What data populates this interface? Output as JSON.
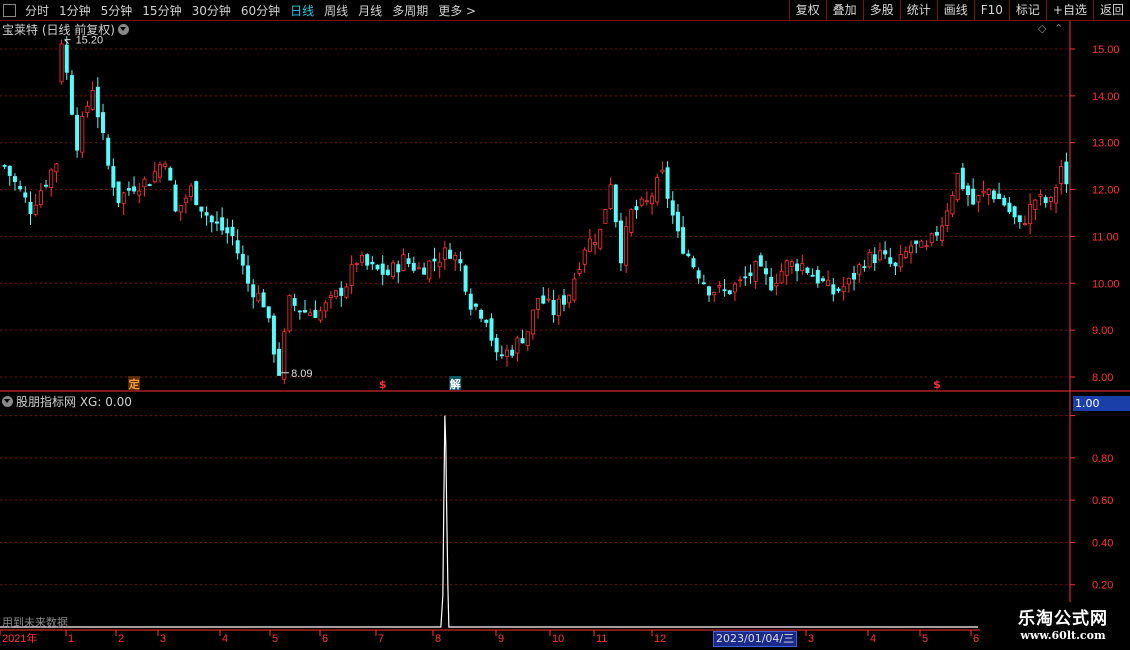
{
  "toolbar": {
    "periods": [
      "分时",
      "1分钟",
      "5分钟",
      "15分钟",
      "30分钟",
      "60分钟",
      "日线",
      "周线",
      "月线",
      "多周期",
      "更多 >"
    ],
    "active_period": "日线",
    "tools": [
      "复权",
      "叠加",
      "多股",
      "统计",
      "画线",
      "F10",
      "标记",
      "+自选",
      "返回"
    ]
  },
  "main_panel": {
    "title": "宝莱特 (日线 前复权)",
    "high_label": "15.20",
    "low_label": "8.09",
    "price_axis": [
      "15.00",
      "14.00",
      "13.00",
      "12.00",
      "11.00",
      "10.00",
      "9.00",
      "8.00"
    ],
    "markers": [
      {
        "text": "定",
        "color": "#ffa040",
        "bg": "#5a2a00",
        "index": 25
      },
      {
        "text": "$",
        "color": "#ff3030",
        "bg": "#000000",
        "index": 73
      },
      {
        "text": "解",
        "color": "#ffffff",
        "bg": "#0a5a6a",
        "index": 87
      },
      {
        "text": "$",
        "color": "#ff3030",
        "bg": "#000000",
        "index": 180
      }
    ]
  },
  "indicator_panel": {
    "title": "股朋指标网 XG: 0.00",
    "value_label": "1.00",
    "axis": [
      "1.00",
      "0.80",
      "0.60",
      "0.40",
      "0.20"
    ],
    "note": "用到未来数据"
  },
  "date_axis": {
    "labels": [
      "2021年",
      "1",
      "2",
      "3",
      "4",
      "5",
      "6",
      "7",
      "8",
      "9",
      "10",
      "11",
      "12",
      "3",
      "4",
      "5",
      "6"
    ],
    "cursor_date": "2023/01/04/三"
  },
  "watermark": {
    "line1": "乐淘公式网",
    "line2": "www.60lt.com"
  },
  "colors": {
    "up": "#ff3232",
    "down": "#54fcfc",
    "axis": "#ff3232",
    "grid": "#7a1010",
    "accent": "#2ec7e6"
  },
  "chart_data": {
    "type": "candlestick",
    "title": "宝莱特 (日线 前复权)",
    "xlabel": "",
    "ylabel": "",
    "ylim": [
      7.8,
      15.6
    ],
    "x_ticks": [
      "2021年",
      "1",
      "2",
      "3",
      "4",
      "5",
      "6",
      "7",
      "8",
      "9",
      "10",
      "11",
      "12",
      "3",
      "4",
      "5",
      "6"
    ],
    "y_ticks": [
      8,
      9,
      10,
      11,
      12,
      13,
      14,
      15
    ],
    "grid": true,
    "annotations": [
      {
        "text": "15.20",
        "value": 15.2
      },
      {
        "text": "8.09",
        "value": 8.09
      }
    ],
    "close_path": [
      [
        0,
        12.5
      ],
      [
        5,
        11.6
      ],
      [
        8,
        12.2
      ],
      [
        10,
        12.6
      ],
      [
        11,
        15.2
      ],
      [
        14,
        13.0
      ],
      [
        17,
        14.2
      ],
      [
        20,
        12.5
      ],
      [
        22,
        11.8
      ],
      [
        25,
        12.1
      ],
      [
        28,
        12.2
      ],
      [
        31,
        12.7
      ],
      [
        33,
        11.5
      ],
      [
        36,
        12.0
      ],
      [
        40,
        11.3
      ],
      [
        44,
        11.0
      ],
      [
        47,
        10.0
      ],
      [
        50,
        9.6
      ],
      [
        53,
        8.1
      ],
      [
        55,
        9.6
      ],
      [
        58,
        9.4
      ],
      [
        61,
        9.4
      ],
      [
        63,
        9.6
      ],
      [
        66,
        10.0
      ],
      [
        68,
        10.5
      ],
      [
        71,
        10.3
      ],
      [
        74,
        10.2
      ],
      [
        77,
        10.5
      ],
      [
        80,
        10.3
      ],
      [
        83,
        10.5
      ],
      [
        86,
        10.7
      ],
      [
        88,
        10.4
      ],
      [
        90,
        9.6
      ],
      [
        93,
        9.3
      ],
      [
        95,
        8.4
      ],
      [
        98,
        8.6
      ],
      [
        101,
        9.0
      ],
      [
        103,
        9.7
      ],
      [
        106,
        9.4
      ],
      [
        109,
        9.8
      ],
      [
        112,
        10.8
      ],
      [
        115,
        11.1
      ],
      [
        117,
        12.2
      ],
      [
        119,
        10.6
      ],
      [
        121,
        11.5
      ],
      [
        124,
        11.7
      ],
      [
        127,
        12.3
      ],
      [
        130,
        11.0
      ],
      [
        133,
        10.4
      ],
      [
        136,
        9.9
      ],
      [
        139,
        9.8
      ],
      [
        142,
        10.0
      ],
      [
        145,
        10.3
      ],
      [
        148,
        10.0
      ],
      [
        151,
        10.4
      ],
      [
        154,
        10.4
      ],
      [
        157,
        10.1
      ],
      [
        160,
        9.8
      ],
      [
        163,
        10.0
      ],
      [
        166,
        10.5
      ],
      [
        169,
        10.6
      ],
      [
        172,
        10.3
      ],
      [
        175,
        10.8
      ],
      [
        178,
        10.7
      ],
      [
        181,
        11.3
      ],
      [
        184,
        12.3
      ],
      [
        187,
        11.7
      ],
      [
        190,
        12.0
      ],
      [
        193,
        11.7
      ],
      [
        196,
        11.2
      ],
      [
        199,
        11.8
      ],
      [
        202,
        11.7
      ],
      [
        204,
        12.5
      ],
      [
        205,
        12.0
      ]
    ],
    "indicator": {
      "series": "XG",
      "signal_index": 85,
      "peak": 1.0,
      "ylim": [
        0,
        1.05
      ]
    }
  }
}
